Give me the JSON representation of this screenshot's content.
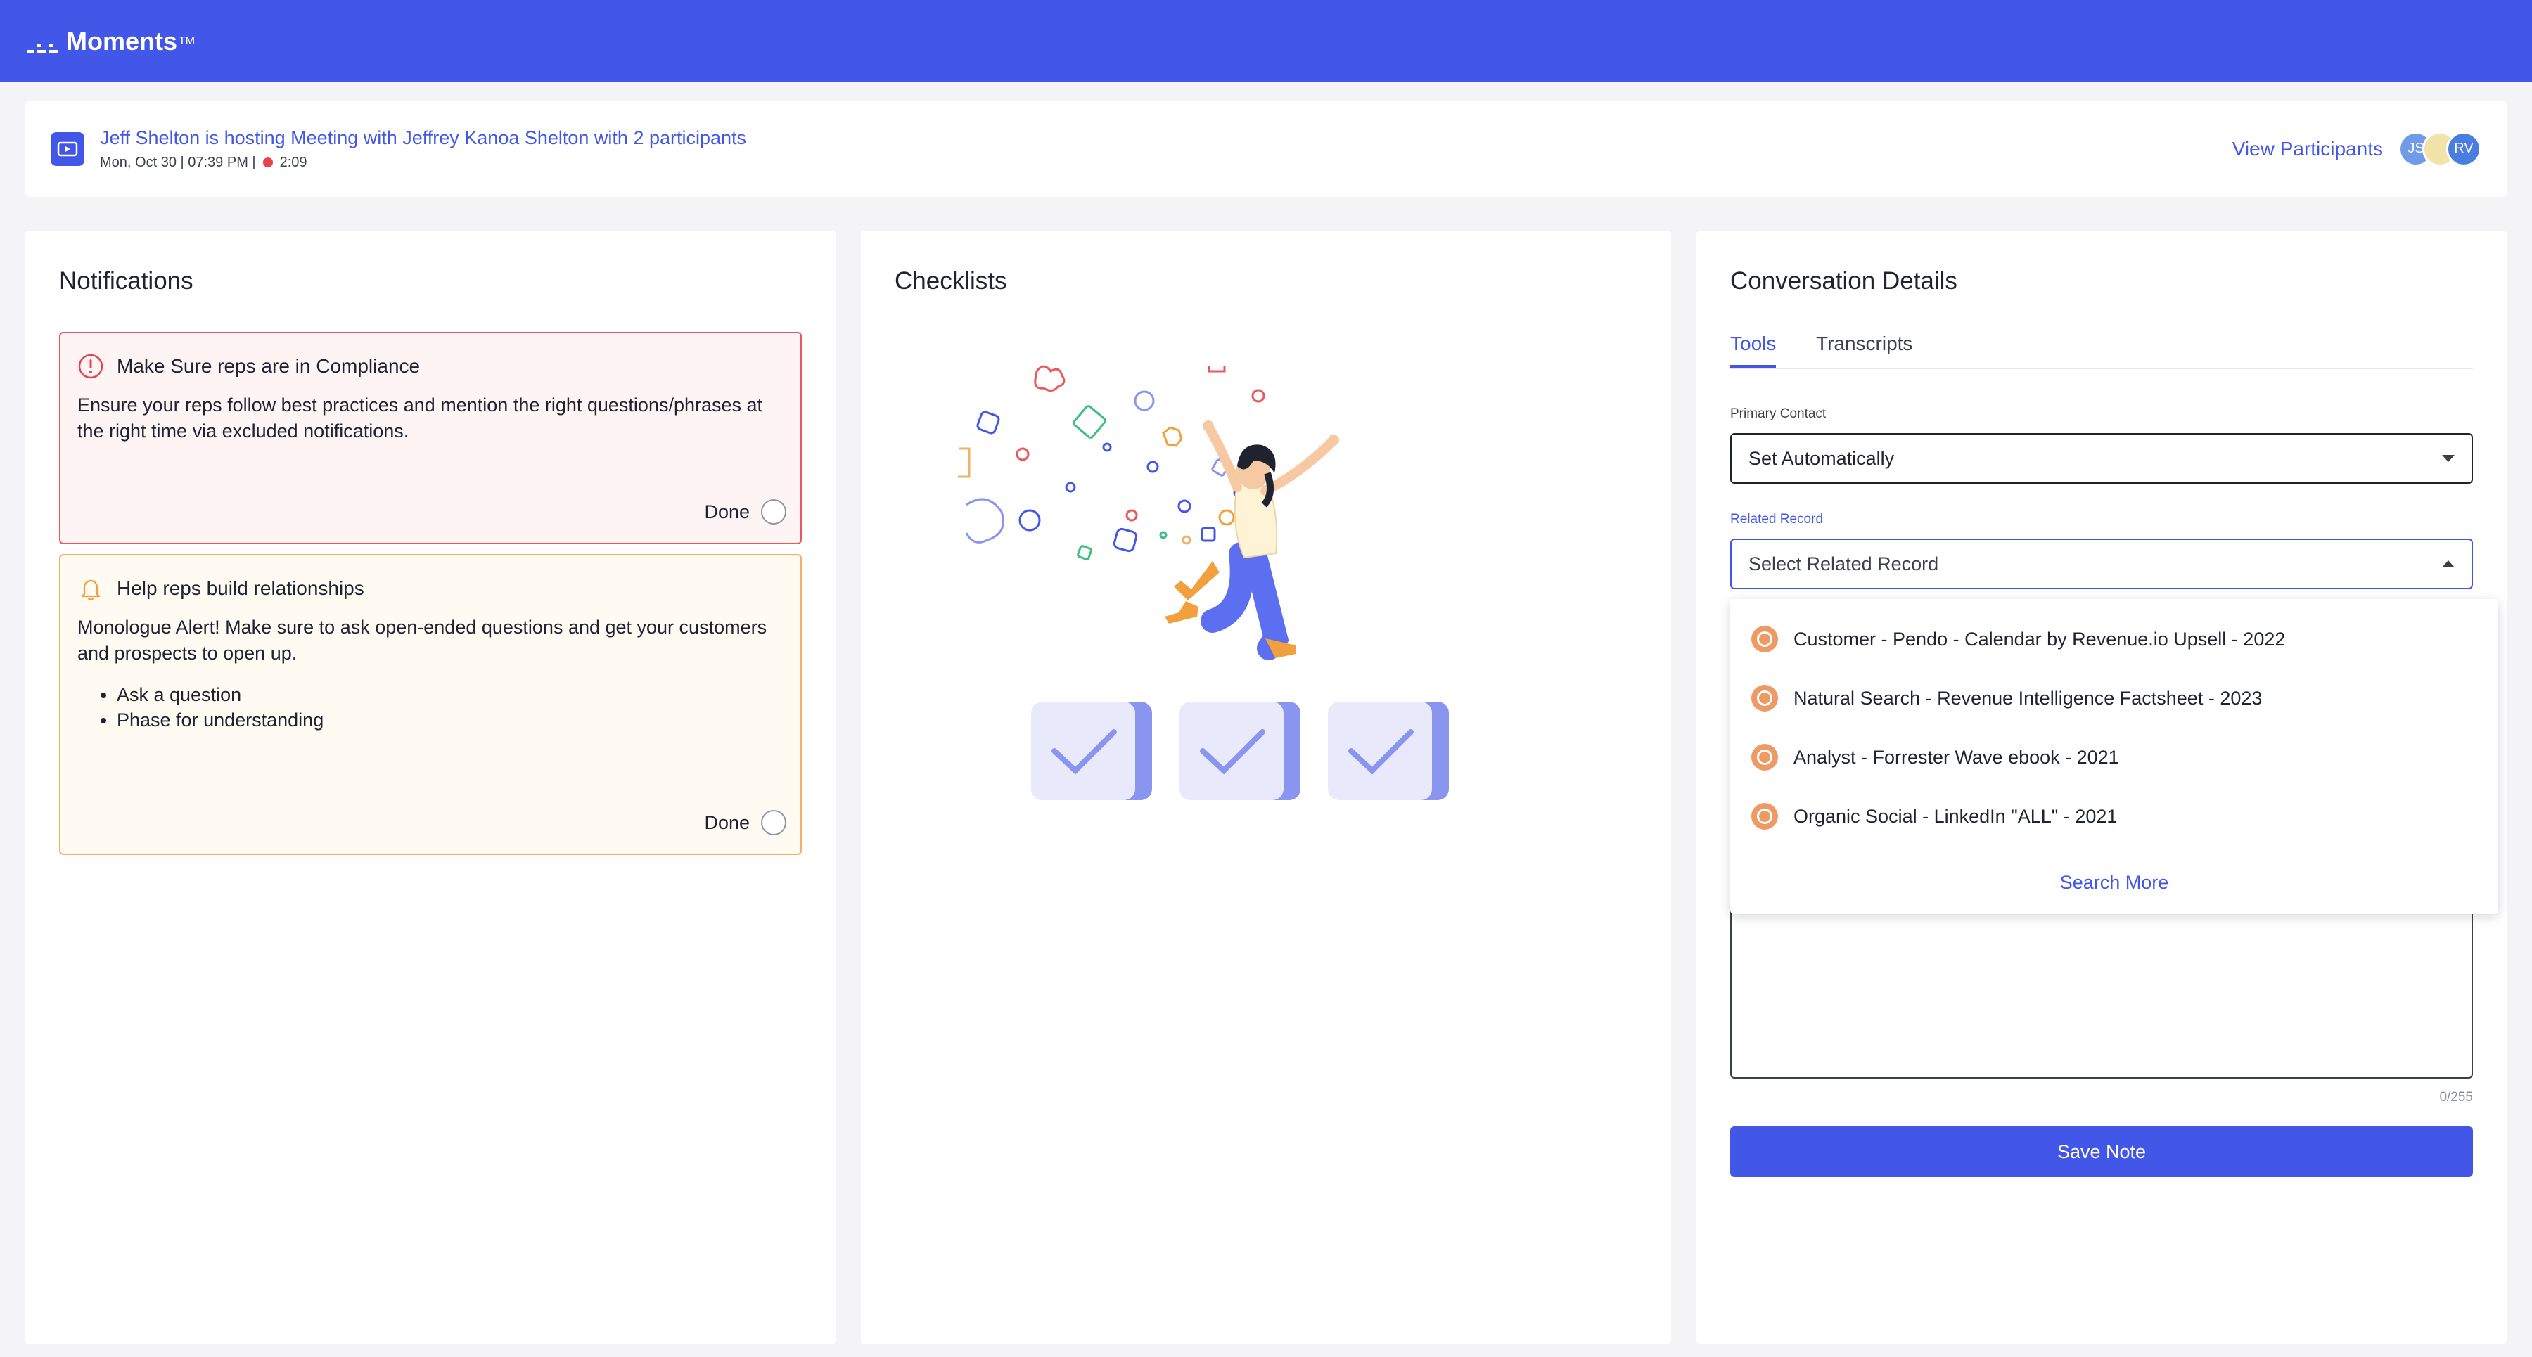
{
  "app": {
    "brand": "Moments",
    "tm": "TM"
  },
  "meeting": {
    "title": "Jeff Shelton is hosting Meeting with Jeffrey Kanoa Shelton with 2 participants",
    "datetime": "Mon, Oct 30 | 07:39 PM |",
    "duration": "2:09",
    "view_participants": "View Participants",
    "avatars": [
      {
        "initials": "JS",
        "color": "#6f9be8"
      },
      {
        "initials": "",
        "color": "#f2e3a8"
      },
      {
        "initials": "RV",
        "color": "#4a7de0"
      }
    ]
  },
  "notifications": {
    "title": "Notifications",
    "cards": [
      {
        "heading": "Make Sure reps are in Compliance",
        "body": "Ensure your reps follow best practices and mention the right questions/phrases at the right time via excluded notifications.",
        "done": "Done"
      },
      {
        "heading": "Help reps build relationships",
        "body": "Monologue Alert! Make sure to ask open-ended questions and get your customers and prospects to open up.",
        "bullets": [
          "Ask a question",
          "Phase for understanding"
        ],
        "done": "Done"
      }
    ]
  },
  "checklists": {
    "title": "Checklists"
  },
  "conversation": {
    "title": "Conversation Details",
    "tabs": [
      {
        "label": "Tools",
        "active": true
      },
      {
        "label": "Transcripts",
        "active": false
      }
    ],
    "primary_contact_label": "Primary Contact",
    "primary_contact_value": "Set Automatically",
    "related_record_label": "Related Record",
    "related_record_placeholder": "Select Related Record",
    "options": [
      "Customer - Pendo - Calendar by Revenue.io Upsell - 2022",
      "Natural Search - Revenue Intelligence Factsheet - 2023",
      "Analyst - Forrester Wave ebook - 2021",
      "Organic Social - LinkedIn \"ALL\" - 2021"
    ],
    "search_more": "Search More",
    "note_counter": "0/255",
    "save_note": "Save Note"
  },
  "colors": {
    "accent": "#4257e8",
    "alert_red": "#e8585d",
    "alert_amber": "#f2b165",
    "option_icon": "#ed9a64"
  }
}
